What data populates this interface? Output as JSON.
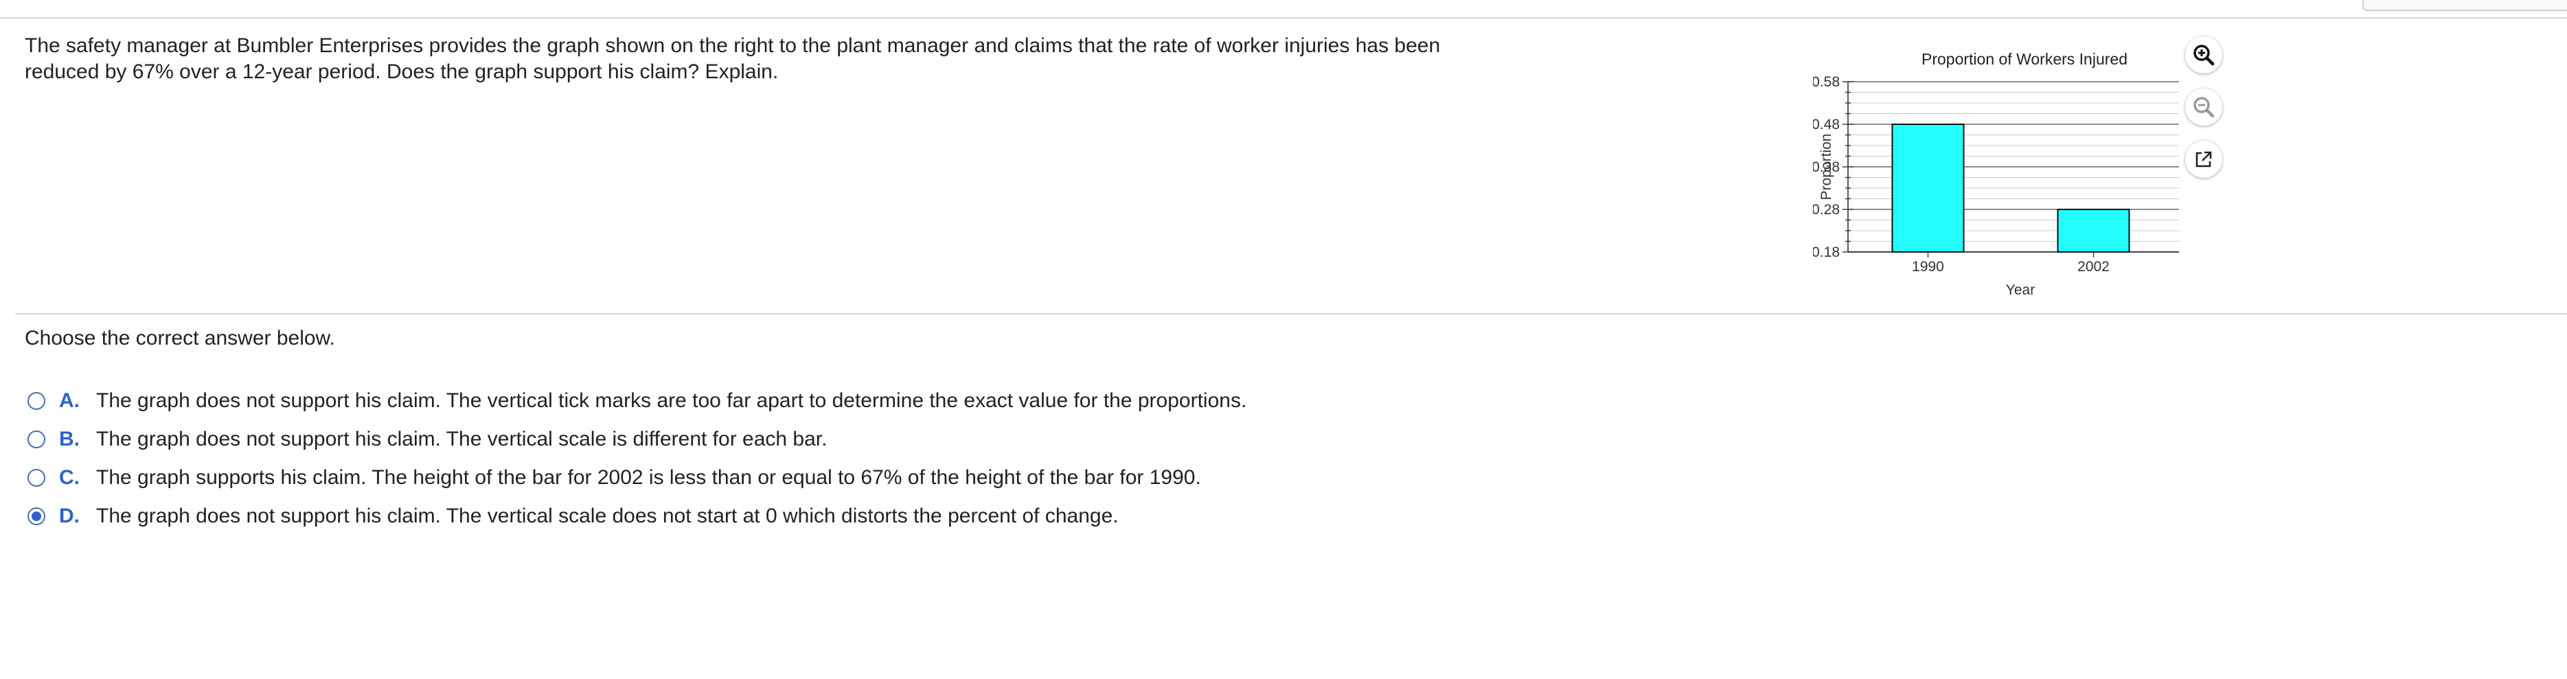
{
  "question": {
    "text": "The safety manager at Bumbler Enterprises provides the graph shown on the right to the plant manager and claims that the rate of worker injuries has been reduced by 67% over a 12-year period. Does the graph support his claim? Explain."
  },
  "prompt": "Choose the correct answer below.",
  "options": [
    {
      "letter": "A.",
      "text": "The graph does not support his claim. The vertical tick marks are too far apart to determine the exact value for the proportions.",
      "selected": false
    },
    {
      "letter": "B.",
      "text": "The graph does not support his claim. The vertical scale is different for each bar.",
      "selected": false
    },
    {
      "letter": "C.",
      "text": "The graph supports his claim. The height of the bar for 2002 is less than or equal to 67% of the height of the bar for 1990.",
      "selected": false
    },
    {
      "letter": "D.",
      "text": "The graph does not support his claim. The vertical scale does not start at 0 which distorts the percent of change.",
      "selected": true
    }
  ],
  "tools": [
    {
      "name": "zoom-in-icon"
    },
    {
      "name": "zoom-out-icon"
    },
    {
      "name": "open-new-window-icon"
    }
  ],
  "colors": {
    "bar_fill": "#22fcfc",
    "accent": "#2e64c8"
  },
  "chart_data": {
    "type": "bar",
    "title": "Proportion of Workers Injured",
    "xlabel": "Year",
    "ylabel": "Proportion",
    "categories": [
      "1990",
      "2002"
    ],
    "values": [
      0.48,
      0.28
    ],
    "ylim": [
      0.18,
      0.58
    ],
    "yticks": [
      "0.58",
      "0.48",
      "0.38",
      "0.28",
      "0.18"
    ],
    "grid": true
  }
}
